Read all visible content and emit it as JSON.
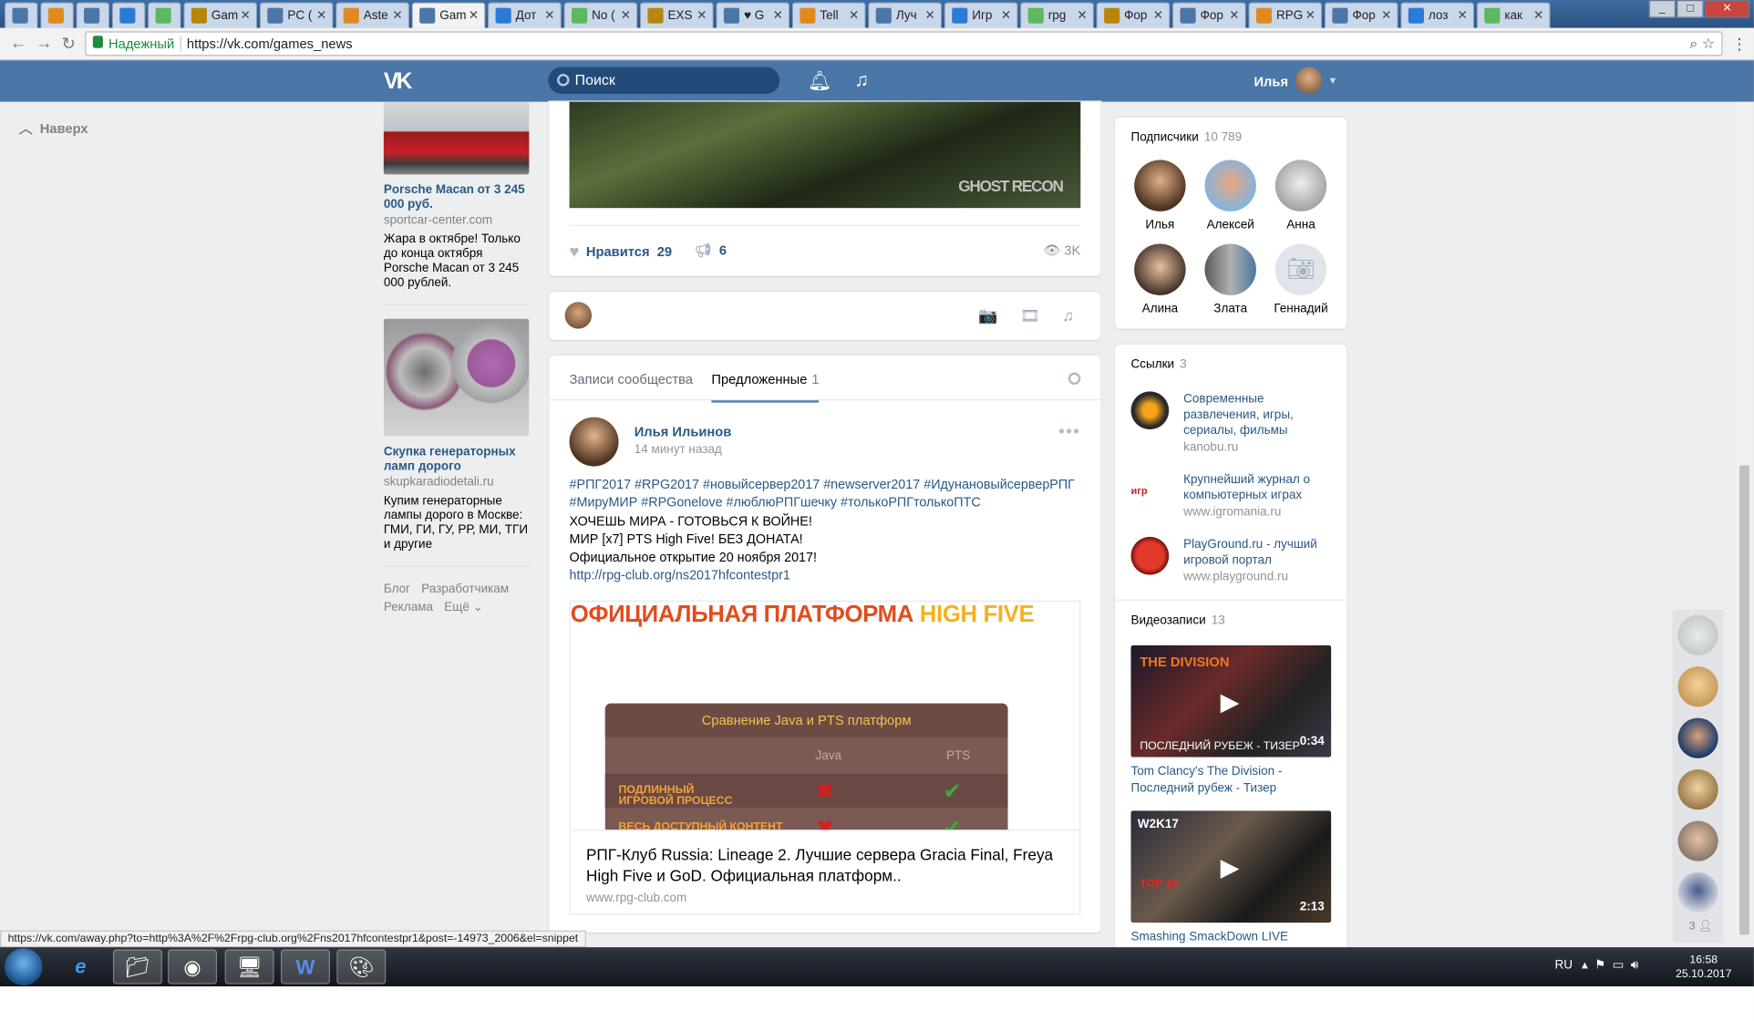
{
  "browser": {
    "tabs": [
      "",
      "",
      "",
      "",
      "",
      "Gam",
      "PC (",
      "Aste",
      "Gam",
      "Дот",
      "No (",
      "EXS",
      "♥ G",
      "Tell",
      "Луч",
      "Игр",
      "rpg",
      "Фор",
      "Фор",
      "RPG",
      "Фор",
      "лоз",
      "как"
    ],
    "secure_label": "Надежный",
    "url": "https://vk.com/games_news",
    "status_url": "https://vk.com/away.php?to=http%3A%2F%2Frpg-club.org%2Fns2017hfcontestpr1&post=-14973_2006&el=snippet"
  },
  "header": {
    "logo": "VK",
    "search_placeholder": "Поиск",
    "user_name": "Илья"
  },
  "left": {
    "up_label": "Наверх"
  },
  "ads": [
    {
      "title": "Porsche Macan от 3 245 000 руб.",
      "domain": "sportcar-center.com",
      "text": "Жара в октябре! Только до конца октября Porsche Macan от 3 245 000 рублей."
    },
    {
      "title": "Скупка генераторных ламп дорого",
      "domain": "skupkaradiodetali.ru",
      "text": "Купим генераторные лампы дорого в Москве: ГМИ, ГИ, ГУ, РР, МИ, ТГИ и другие"
    }
  ],
  "footer_links": [
    "Блог",
    "Разработчикам",
    "Реклама",
    "Ещё ⌄"
  ],
  "top_post": {
    "image_watermark": "GHOST RECON",
    "like_label": "Нравится",
    "likes": "29",
    "shares": "6",
    "views": "3K"
  },
  "composer": {
    "attach_icons": "📷 🎞 ♫"
  },
  "wall_tabs": {
    "tab1": "Записи сообщества",
    "tab2": "Предложенные",
    "tab2_count": "1"
  },
  "post": {
    "author": "Илья Ильинов",
    "time": "14 минут назад",
    "hashtags": "#РПГ2017 #RPG2017 #новыйсервер2017 #newserver2017 #ИдунановыйсерверРПГ #МируМИР #RPGonelove #люблюРПГшечку #толькоРПГтолькоПТС",
    "line1": "ХОЧЕШЬ МИРА - ГОТОВЬСЯ К ВОЙНЕ!",
    "line2": "МИР [x7] PTS High Five! БЕЗ ДОНАТА!",
    "line3": "Официальное открытие 20 ноября 2017!",
    "link": "http://rpg-club.org/ns2017hfcontestpr1",
    "banner_head_a": "ОФИЦИАЛЬНАЯ ПЛАТФОРМА ",
    "banner_head_b": "HIGH FIVE",
    "table_title": "Сравнение Java и PTS платформ",
    "col_java": "Java",
    "col_pts": "PTS",
    "row1": "ПОДЛИННЫЙ ИГРОВОЙ ПРОЦЕСС",
    "row2": "ВЕСЬ ДОСТУПНЫЙ КОНТЕНТ",
    "snippet_title": "РПГ-Клуб Russia: Lineage 2. Лучшие сервера Gracia Final, Freya High Five и GoD. Официальная платформ..",
    "snippet_domain": "www.rpg-club.com"
  },
  "followers": {
    "label": "Подписчики",
    "count": "10 789",
    "members": [
      "Илья",
      "Алексей",
      "Анна",
      "Алина",
      "Злата",
      "Геннадий"
    ]
  },
  "links": {
    "label": "Ссылки",
    "count": "3",
    "items": [
      {
        "title": "Современные развлечения, игры, сериалы, фильмы",
        "domain": "kanobu.ru"
      },
      {
        "title": "Крупнейший журнал о компьютерных играх",
        "domain": "www.igromania.ru"
      },
      {
        "title": "PlayGround.ru - лучший игровой портал",
        "domain": "www.playground.ru"
      }
    ]
  },
  "videos": {
    "label": "Видеозаписи",
    "count": "13",
    "items": [
      {
        "title": "Tom Clancy's The Division - Последний рубеж - Тизер",
        "duration": "0:34",
        "overlay": "ПОСЛЕДНИЙ РУБЕЖ - ТИЗЕР",
        "badge": "THE DIVISION"
      },
      {
        "title": "Smashing SmackDown LIVE",
        "duration": "2:13",
        "badge": "W2K17",
        "badge2": "TOP 10"
      }
    ]
  },
  "friends_count": "3",
  "taskbar": {
    "lang": "RU",
    "time": "16:58",
    "date": "25.10.2017"
  }
}
